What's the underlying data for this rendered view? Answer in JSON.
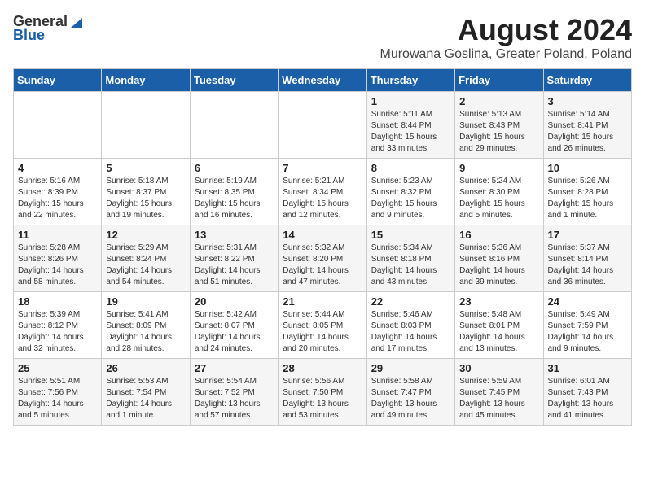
{
  "header": {
    "logo_general": "General",
    "logo_blue": "Blue",
    "month_title": "August 2024",
    "subtitle": "Murowana Goslina, Greater Poland, Poland"
  },
  "weekdays": [
    "Sunday",
    "Monday",
    "Tuesday",
    "Wednesday",
    "Thursday",
    "Friday",
    "Saturday"
  ],
  "weeks": [
    [
      {
        "day": "",
        "info": ""
      },
      {
        "day": "",
        "info": ""
      },
      {
        "day": "",
        "info": ""
      },
      {
        "day": "",
        "info": ""
      },
      {
        "day": "1",
        "info": "Sunrise: 5:11 AM\nSunset: 8:44 PM\nDaylight: 15 hours\nand 33 minutes."
      },
      {
        "day": "2",
        "info": "Sunrise: 5:13 AM\nSunset: 8:43 PM\nDaylight: 15 hours\nand 29 minutes."
      },
      {
        "day": "3",
        "info": "Sunrise: 5:14 AM\nSunset: 8:41 PM\nDaylight: 15 hours\nand 26 minutes."
      }
    ],
    [
      {
        "day": "4",
        "info": "Sunrise: 5:16 AM\nSunset: 8:39 PM\nDaylight: 15 hours\nand 22 minutes."
      },
      {
        "day": "5",
        "info": "Sunrise: 5:18 AM\nSunset: 8:37 PM\nDaylight: 15 hours\nand 19 minutes."
      },
      {
        "day": "6",
        "info": "Sunrise: 5:19 AM\nSunset: 8:35 PM\nDaylight: 15 hours\nand 16 minutes."
      },
      {
        "day": "7",
        "info": "Sunrise: 5:21 AM\nSunset: 8:34 PM\nDaylight: 15 hours\nand 12 minutes."
      },
      {
        "day": "8",
        "info": "Sunrise: 5:23 AM\nSunset: 8:32 PM\nDaylight: 15 hours\nand 9 minutes."
      },
      {
        "day": "9",
        "info": "Sunrise: 5:24 AM\nSunset: 8:30 PM\nDaylight: 15 hours\nand 5 minutes."
      },
      {
        "day": "10",
        "info": "Sunrise: 5:26 AM\nSunset: 8:28 PM\nDaylight: 15 hours\nand 1 minute."
      }
    ],
    [
      {
        "day": "11",
        "info": "Sunrise: 5:28 AM\nSunset: 8:26 PM\nDaylight: 14 hours\nand 58 minutes."
      },
      {
        "day": "12",
        "info": "Sunrise: 5:29 AM\nSunset: 8:24 PM\nDaylight: 14 hours\nand 54 minutes."
      },
      {
        "day": "13",
        "info": "Sunrise: 5:31 AM\nSunset: 8:22 PM\nDaylight: 14 hours\nand 51 minutes."
      },
      {
        "day": "14",
        "info": "Sunrise: 5:32 AM\nSunset: 8:20 PM\nDaylight: 14 hours\nand 47 minutes."
      },
      {
        "day": "15",
        "info": "Sunrise: 5:34 AM\nSunset: 8:18 PM\nDaylight: 14 hours\nand 43 minutes."
      },
      {
        "day": "16",
        "info": "Sunrise: 5:36 AM\nSunset: 8:16 PM\nDaylight: 14 hours\nand 39 minutes."
      },
      {
        "day": "17",
        "info": "Sunrise: 5:37 AM\nSunset: 8:14 PM\nDaylight: 14 hours\nand 36 minutes."
      }
    ],
    [
      {
        "day": "18",
        "info": "Sunrise: 5:39 AM\nSunset: 8:12 PM\nDaylight: 14 hours\nand 32 minutes."
      },
      {
        "day": "19",
        "info": "Sunrise: 5:41 AM\nSunset: 8:09 PM\nDaylight: 14 hours\nand 28 minutes."
      },
      {
        "day": "20",
        "info": "Sunrise: 5:42 AM\nSunset: 8:07 PM\nDaylight: 14 hours\nand 24 minutes."
      },
      {
        "day": "21",
        "info": "Sunrise: 5:44 AM\nSunset: 8:05 PM\nDaylight: 14 hours\nand 20 minutes."
      },
      {
        "day": "22",
        "info": "Sunrise: 5:46 AM\nSunset: 8:03 PM\nDaylight: 14 hours\nand 17 minutes."
      },
      {
        "day": "23",
        "info": "Sunrise: 5:48 AM\nSunset: 8:01 PM\nDaylight: 14 hours\nand 13 minutes."
      },
      {
        "day": "24",
        "info": "Sunrise: 5:49 AM\nSunset: 7:59 PM\nDaylight: 14 hours\nand 9 minutes."
      }
    ],
    [
      {
        "day": "25",
        "info": "Sunrise: 5:51 AM\nSunset: 7:56 PM\nDaylight: 14 hours\nand 5 minutes."
      },
      {
        "day": "26",
        "info": "Sunrise: 5:53 AM\nSunset: 7:54 PM\nDaylight: 14 hours\nand 1 minute."
      },
      {
        "day": "27",
        "info": "Sunrise: 5:54 AM\nSunset: 7:52 PM\nDaylight: 13 hours\nand 57 minutes."
      },
      {
        "day": "28",
        "info": "Sunrise: 5:56 AM\nSunset: 7:50 PM\nDaylight: 13 hours\nand 53 minutes."
      },
      {
        "day": "29",
        "info": "Sunrise: 5:58 AM\nSunset: 7:47 PM\nDaylight: 13 hours\nand 49 minutes."
      },
      {
        "day": "30",
        "info": "Sunrise: 5:59 AM\nSunset: 7:45 PM\nDaylight: 13 hours\nand 45 minutes."
      },
      {
        "day": "31",
        "info": "Sunrise: 6:01 AM\nSunset: 7:43 PM\nDaylight: 13 hours\nand 41 minutes."
      }
    ]
  ]
}
